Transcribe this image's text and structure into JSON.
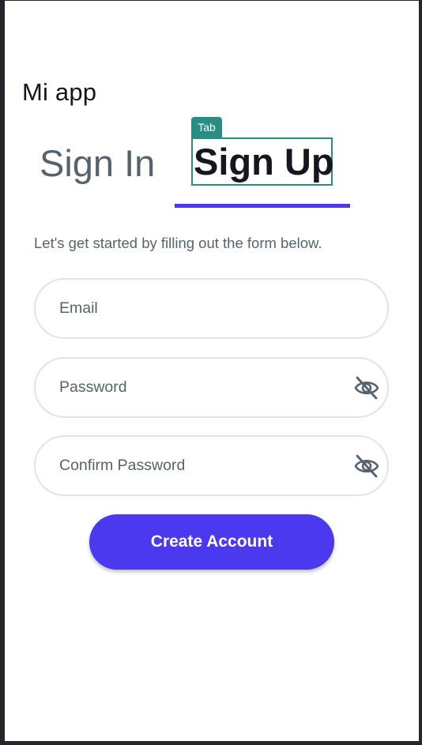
{
  "app": {
    "title": "Mi app"
  },
  "tabs": [
    {
      "label": "Sign In",
      "active": false
    },
    {
      "label": "Sign Up",
      "active": true
    }
  ],
  "inspector_badge": "Tab",
  "form": {
    "subtitle": "Let's get started by filling out the form below.",
    "email_placeholder": "Email",
    "password_placeholder": "Password",
    "confirm_placeholder": "Confirm Password",
    "submit_label": "Create Account"
  },
  "icons": {
    "password_toggle": "eye-off-icon",
    "confirm_toggle": "eye-off-icon"
  },
  "colors": {
    "primary": "#4b39ef",
    "inspector": "#2a8d84",
    "text_secondary": "#57636c",
    "text_primary": "#15161e",
    "border": "#e0e3e7"
  }
}
